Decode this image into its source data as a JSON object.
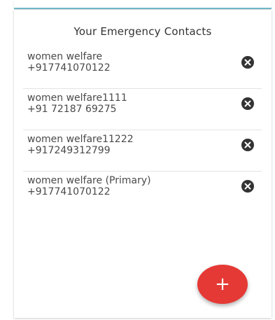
{
  "card": {
    "title": "Your Emergency Contacts"
  },
  "contacts": [
    {
      "name": "women welfare",
      "phone": "+917741070122"
    },
    {
      "name": "women welfare1111",
      "phone": "+91 72187 69275"
    },
    {
      "name": "women welfare11222",
      "phone": "+917249312799"
    },
    {
      "name": "women welfare (Primary)",
      "phone": "+917741070122"
    }
  ],
  "icons": {
    "remove": "close-circle-icon",
    "add": "plus-icon"
  },
  "fab": {
    "label": "+"
  },
  "colors": {
    "accent": "#e53935",
    "top_bar_line": "#6fb9c8",
    "text": "#4a4a4a"
  }
}
